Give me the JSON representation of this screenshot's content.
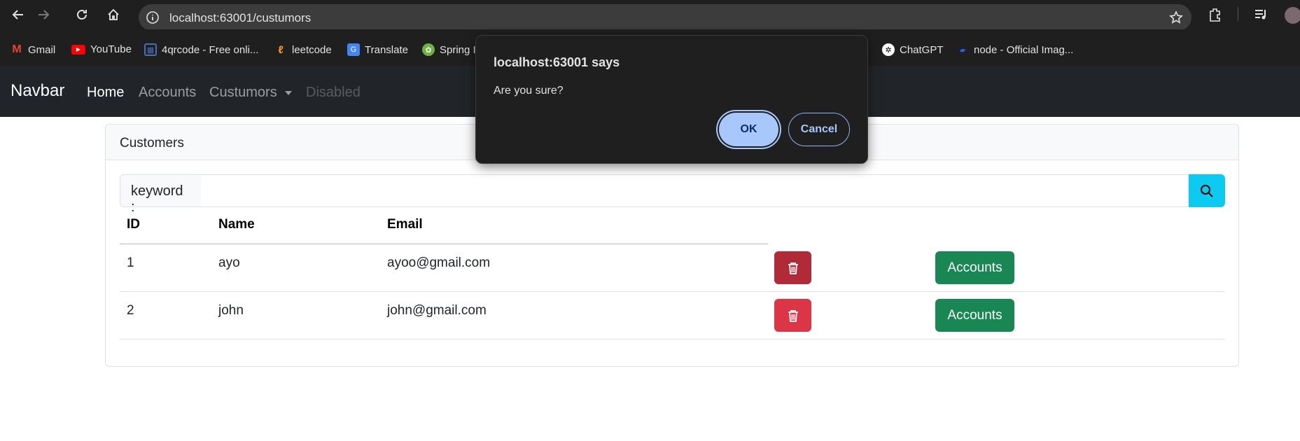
{
  "browser": {
    "url": "localhost:63001/custumors",
    "bookmarks": [
      {
        "label": "Gmail",
        "icon": "gmail-icon",
        "color": "#ea4335"
      },
      {
        "label": "YouTube",
        "icon": "youtube-icon",
        "color": "#ff0000"
      },
      {
        "label": "4qrcode - Free onli...",
        "icon": "qrcode-icon",
        "color": "#4b6cb7"
      },
      {
        "label": "leetcode",
        "icon": "leetcode-icon",
        "color": "#ffa116"
      },
      {
        "label": "Translate",
        "icon": "translate-icon",
        "color": "#4285f4"
      },
      {
        "label": "Spring I",
        "icon": "spring-icon",
        "color": "#6db33f"
      },
      {
        "label": "ChatGPT",
        "icon": "chatgpt-icon",
        "color": "#ffffff"
      },
      {
        "label": "node - Official Imag...",
        "icon": "docker-icon",
        "color": "#1d63ed"
      }
    ]
  },
  "navbar": {
    "brand": "Navbar",
    "links": [
      "Home",
      "Accounts",
      "Custumors",
      "Disabled"
    ]
  },
  "card": {
    "title": "Customers",
    "search_label": "keyword :"
  },
  "table": {
    "headers": [
      "ID",
      "Name",
      "Email"
    ],
    "rows": [
      {
        "id": "1",
        "name": "ayo",
        "email": "ayoo@gmail.com",
        "action": "Accounts"
      },
      {
        "id": "2",
        "name": "john",
        "email": "john@gmail.com",
        "action": "Accounts"
      }
    ]
  },
  "dialog": {
    "title": "localhost:63001 says",
    "message": "Are you sure?",
    "ok": "OK",
    "cancel": "Cancel"
  },
  "colors": {
    "danger": "#dc3545",
    "success": "#198754",
    "info": "#0dcaf0",
    "navbar_bg": "#212529",
    "dialog_accent": "#a8c7fa"
  }
}
